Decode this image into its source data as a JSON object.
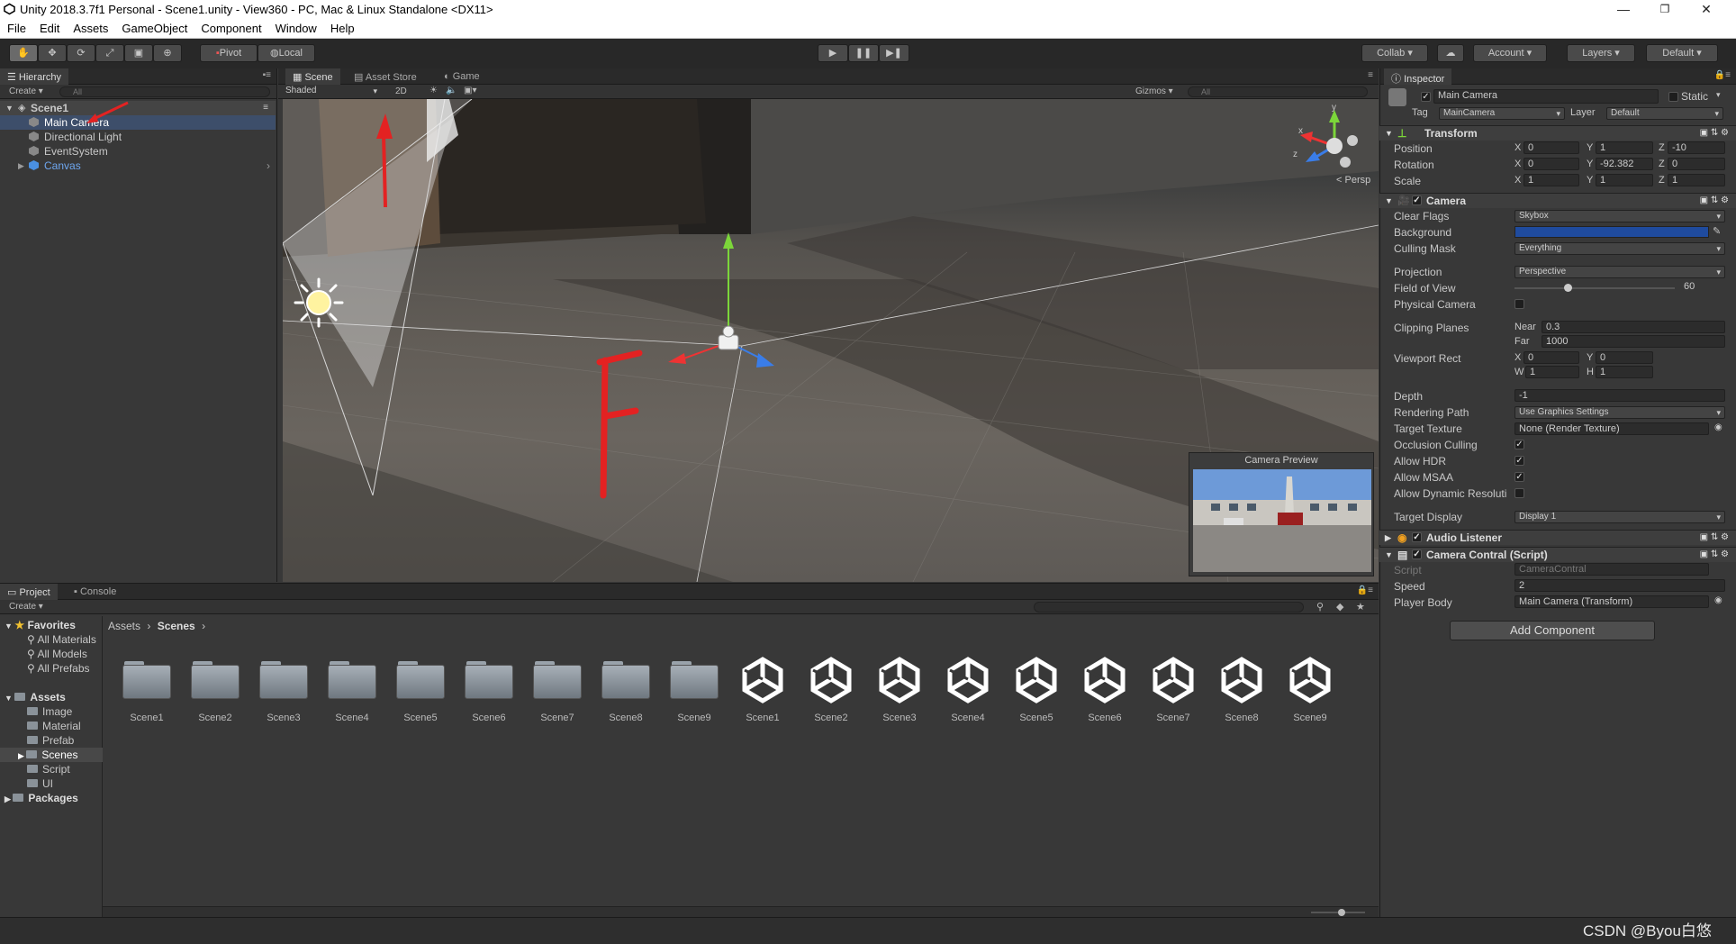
{
  "window": {
    "title": "Unity 2018.3.7f1 Personal - Scene1.unity - View360 - PC, Mac & Linux Standalone <DX11>",
    "minimize": "—",
    "maximize": "❐",
    "close": "✕"
  },
  "menu": [
    "File",
    "Edit",
    "Assets",
    "GameObject",
    "Component",
    "Window",
    "Help"
  ],
  "toolbar": {
    "pivot": "Pivot",
    "local": "Local",
    "collab": "Collab ▾",
    "account": "Account",
    "layers": "Layers",
    "layout": "Default"
  },
  "hierarchy": {
    "tab": "Hierarchy",
    "create": "Create ▾",
    "search_placeholder": "All",
    "scene": "Scene1",
    "items": [
      "Main Camera",
      "Directional Light",
      "EventSystem",
      "Canvas"
    ]
  },
  "scene": {
    "tabs": [
      "Scene",
      "Asset Store",
      "Game"
    ],
    "shading": "Shaded",
    "mode2d": "2D",
    "gizmos": "Gizmos ▾",
    "search_placeholder": "All",
    "persp": "Persp",
    "axis_y": "y",
    "axis_x": "x",
    "axis_z": "z",
    "annotation": "F",
    "preview_title": "Camera Preview"
  },
  "project": {
    "tabs": [
      "Project",
      "Console"
    ],
    "create": "Create ▾",
    "favorites_label": "Favorites",
    "favorites": [
      "All Materials",
      "All Models",
      "All Prefabs"
    ],
    "assets_label": "Assets",
    "asset_folders": [
      "Image",
      "Material",
      "Prefab",
      "Scenes",
      "Script",
      "UI"
    ],
    "packages_label": "Packages",
    "breadcrumb": [
      "Assets",
      "Scenes"
    ],
    "folders": [
      "Scene1",
      "Scene2",
      "Scene3",
      "Scene4",
      "Scene5",
      "Scene6",
      "Scene7",
      "Scene8",
      "Scene9"
    ],
    "scene_files": [
      "Scene1",
      "Scene2",
      "Scene3",
      "Scene4",
      "Scene5",
      "Scene6",
      "Scene7",
      "Scene8",
      "Scene9"
    ]
  },
  "inspector": {
    "tab": "Inspector",
    "object_name": "Main Camera",
    "static": "Static",
    "tag_label": "Tag",
    "tag": "MainCamera",
    "layer_label": "Layer",
    "layer": "Default",
    "transform": {
      "title": "Transform",
      "position_label": "Position",
      "position": [
        "0",
        "1",
        "-10"
      ],
      "rotation_label": "Rotation",
      "rotation": [
        "0",
        "-92.382",
        "0"
      ],
      "scale_label": "Scale",
      "scale": [
        "1",
        "1",
        "1"
      ]
    },
    "camera": {
      "title": "Camera",
      "clear_flags_label": "Clear Flags",
      "clear_flags": "Skybox",
      "background_label": "Background",
      "background_color": "#1f4b9e",
      "culling_mask_label": "Culling Mask",
      "culling_mask": "Everything",
      "projection_label": "Projection",
      "projection": "Perspective",
      "fov_label": "Field of View",
      "fov": "60",
      "fov_fraction": 0.33,
      "physical_label": "Physical Camera",
      "clipping_label": "Clipping Planes",
      "near_label": "Near",
      "near": "0.3",
      "far_label": "Far",
      "far": "1000",
      "viewport_label": "Viewport Rect",
      "vx": "0",
      "vy": "0",
      "vw": "1",
      "vh": "1",
      "depth_label": "Depth",
      "depth": "-1",
      "rendering_label": "Rendering Path",
      "rendering": "Use Graphics Settings",
      "target_texture_label": "Target Texture",
      "target_texture": "None (Render Texture)",
      "occlusion_label": "Occlusion Culling",
      "hdr_label": "Allow HDR",
      "msaa_label": "Allow MSAA",
      "dynamic_label": "Allow Dynamic Resoluti",
      "target_display_label": "Target Display",
      "target_display": "Display 1"
    },
    "audio_listener": "Audio Listener",
    "script": {
      "title": "Camera Contral (Script)",
      "script_label": "Script",
      "script_value": "CameraContral",
      "speed_label": "Speed",
      "speed": "2",
      "body_label": "Player Body",
      "body": "Main Camera (Transform)"
    },
    "add_component": "Add Component"
  },
  "watermark": "CSDN @Byou白悠"
}
